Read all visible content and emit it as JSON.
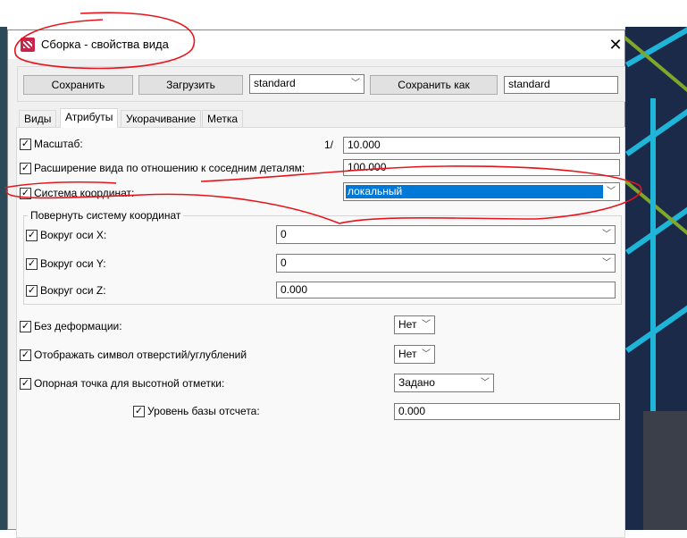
{
  "window": {
    "title": "Сборка - свойства вида",
    "close": "✕"
  },
  "toolbar": {
    "save": "Сохранить",
    "load": "Загрузить",
    "preset": "standard",
    "save_as": "Сохранить как",
    "save_as_name": "standard"
  },
  "tabs": [
    "Виды",
    "Атрибуты",
    "Укорачивание",
    "Метка"
  ],
  "attributes": {
    "scale": {
      "label": "Масштаб:",
      "prefix": "1/",
      "value": "10.000"
    },
    "extension": {
      "label": "Расширение вида по отношению к соседним деталям:",
      "value": "100.000"
    },
    "coord_system": {
      "label": "Система координат:",
      "value": "локальный"
    },
    "rotate_group": "Повернуть систему координат",
    "rot_x": {
      "label": "Вокруг оси X:",
      "value": "0"
    },
    "rot_y": {
      "label": "Вокруг оси Y:",
      "value": "0"
    },
    "rot_z": {
      "label": "Вокруг оси Z:",
      "value": "0.000"
    },
    "no_deform": {
      "label": "Без деформации:",
      "value": "Нет"
    },
    "show_holes": {
      "label": "Отображать символ отверстий/углублений",
      "value": "Нет"
    },
    "ref_point": {
      "label": "Опорная точка для высотной отметки:",
      "value": "Задано"
    },
    "base_level": {
      "label": "Уровень базы отсчета:",
      "value": "0.000"
    }
  },
  "check": "✓",
  "chevron": "﹀"
}
